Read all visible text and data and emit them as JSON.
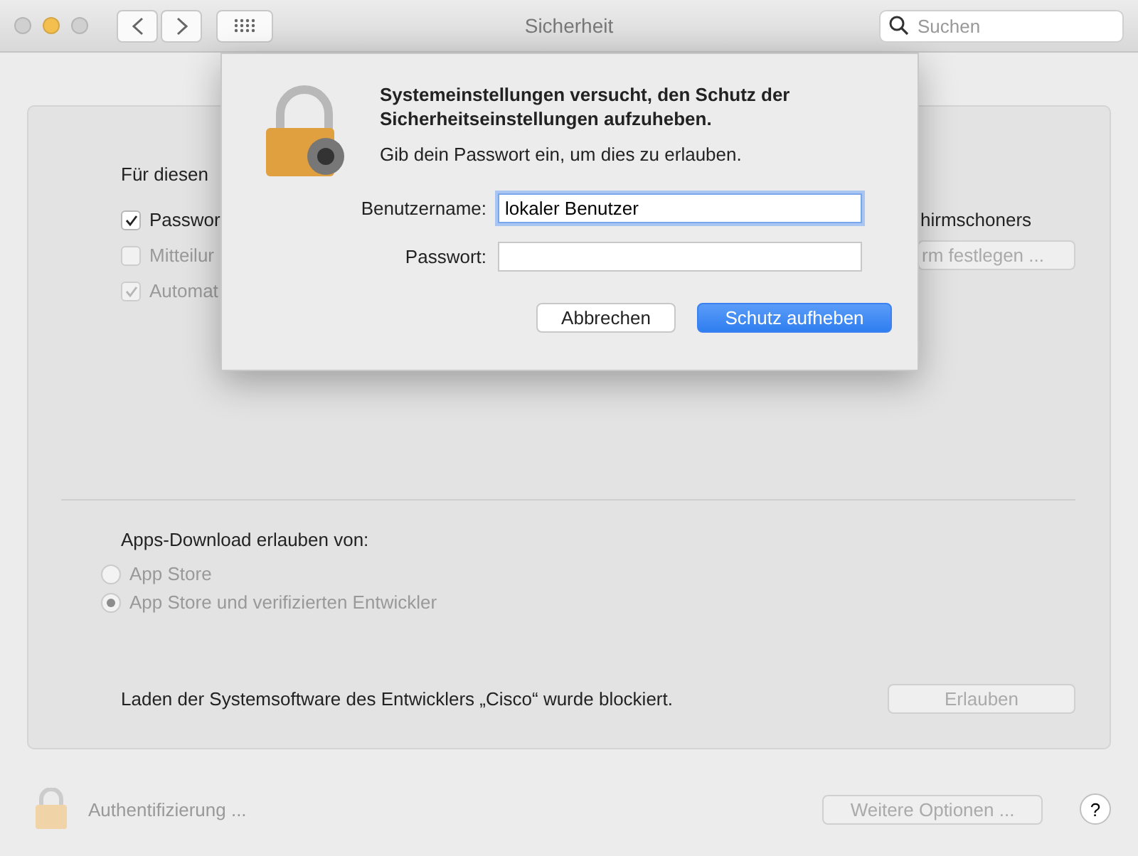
{
  "window": {
    "title": "Sicherheit",
    "search": {
      "placeholder": "Suchen"
    }
  },
  "general": {
    "heading": "Für diesen",
    "options": [
      {
        "label": "Passwor",
        "checked": true,
        "disabled": false,
        "side_text": "hirmschoners"
      },
      {
        "label": "Mitteilur",
        "checked": false,
        "disabled": true,
        "side_button": "rm festlegen ..."
      },
      {
        "label": "Automat",
        "checked": true,
        "disabled": true
      }
    ]
  },
  "downloads": {
    "label": "Apps-Download erlauben von:",
    "disabled": true,
    "options": [
      {
        "label": "App Store",
        "selected": false
      },
      {
        "label": "App Store und verifizierten Entwickler",
        "selected": true
      }
    ]
  },
  "blocked": {
    "message": "Laden der Systemsoftware des Entwicklers „Cisco“ wurde blockiert.",
    "button": "Erlauben"
  },
  "footer": {
    "lock_label": "Authentifizierung ...",
    "more_button": "Weitere Optionen ...",
    "help": "?"
  },
  "dialog": {
    "title": "Systemeinstellungen versucht, den Schutz der Sicherheitseinstellungen aufzuheben.",
    "message": "Gib dein Passwort ein, um dies zu erlauben.",
    "fields": [
      {
        "label": "Benutzername:",
        "value": "lokaler Benutzer",
        "focused": true
      },
      {
        "label": "Passwort:",
        "focused": false
      }
    ],
    "buttons": [
      {
        "label": "Abbrechen",
        "kind": "secondary"
      },
      {
        "label": "Schutz aufheben",
        "kind": "primary"
      }
    ]
  }
}
